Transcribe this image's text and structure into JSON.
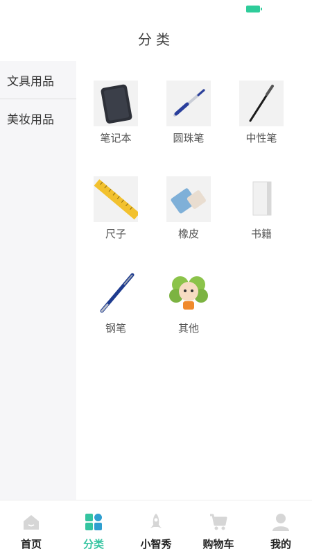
{
  "header": {
    "title": "分类"
  },
  "sidebar": {
    "items": [
      {
        "label": "文具用品"
      },
      {
        "label": "美妆用品"
      }
    ]
  },
  "products": [
    {
      "label": "笔记本",
      "icon": "notebook-icon"
    },
    {
      "label": "圆珠笔",
      "icon": "ballpoint-pen-icon"
    },
    {
      "label": "中性笔",
      "icon": "gel-pen-icon"
    },
    {
      "label": "尺子",
      "icon": "ruler-icon"
    },
    {
      "label": "橡皮",
      "icon": "eraser-icon"
    },
    {
      "label": "书籍",
      "icon": "book-icon"
    },
    {
      "label": "钢笔",
      "icon": "fountain-pen-icon"
    },
    {
      "label": "其他",
      "icon": "mascot-icon"
    }
  ],
  "tabbar": {
    "active_color": "#34c4a0",
    "items": [
      {
        "label": "首页",
        "icon": "home-icon"
      },
      {
        "label": "分类",
        "icon": "category-icon"
      },
      {
        "label": "小智秀",
        "icon": "rocket-icon"
      },
      {
        "label": "购物车",
        "icon": "cart-icon"
      },
      {
        "label": "我的",
        "icon": "user-icon"
      }
    ]
  }
}
